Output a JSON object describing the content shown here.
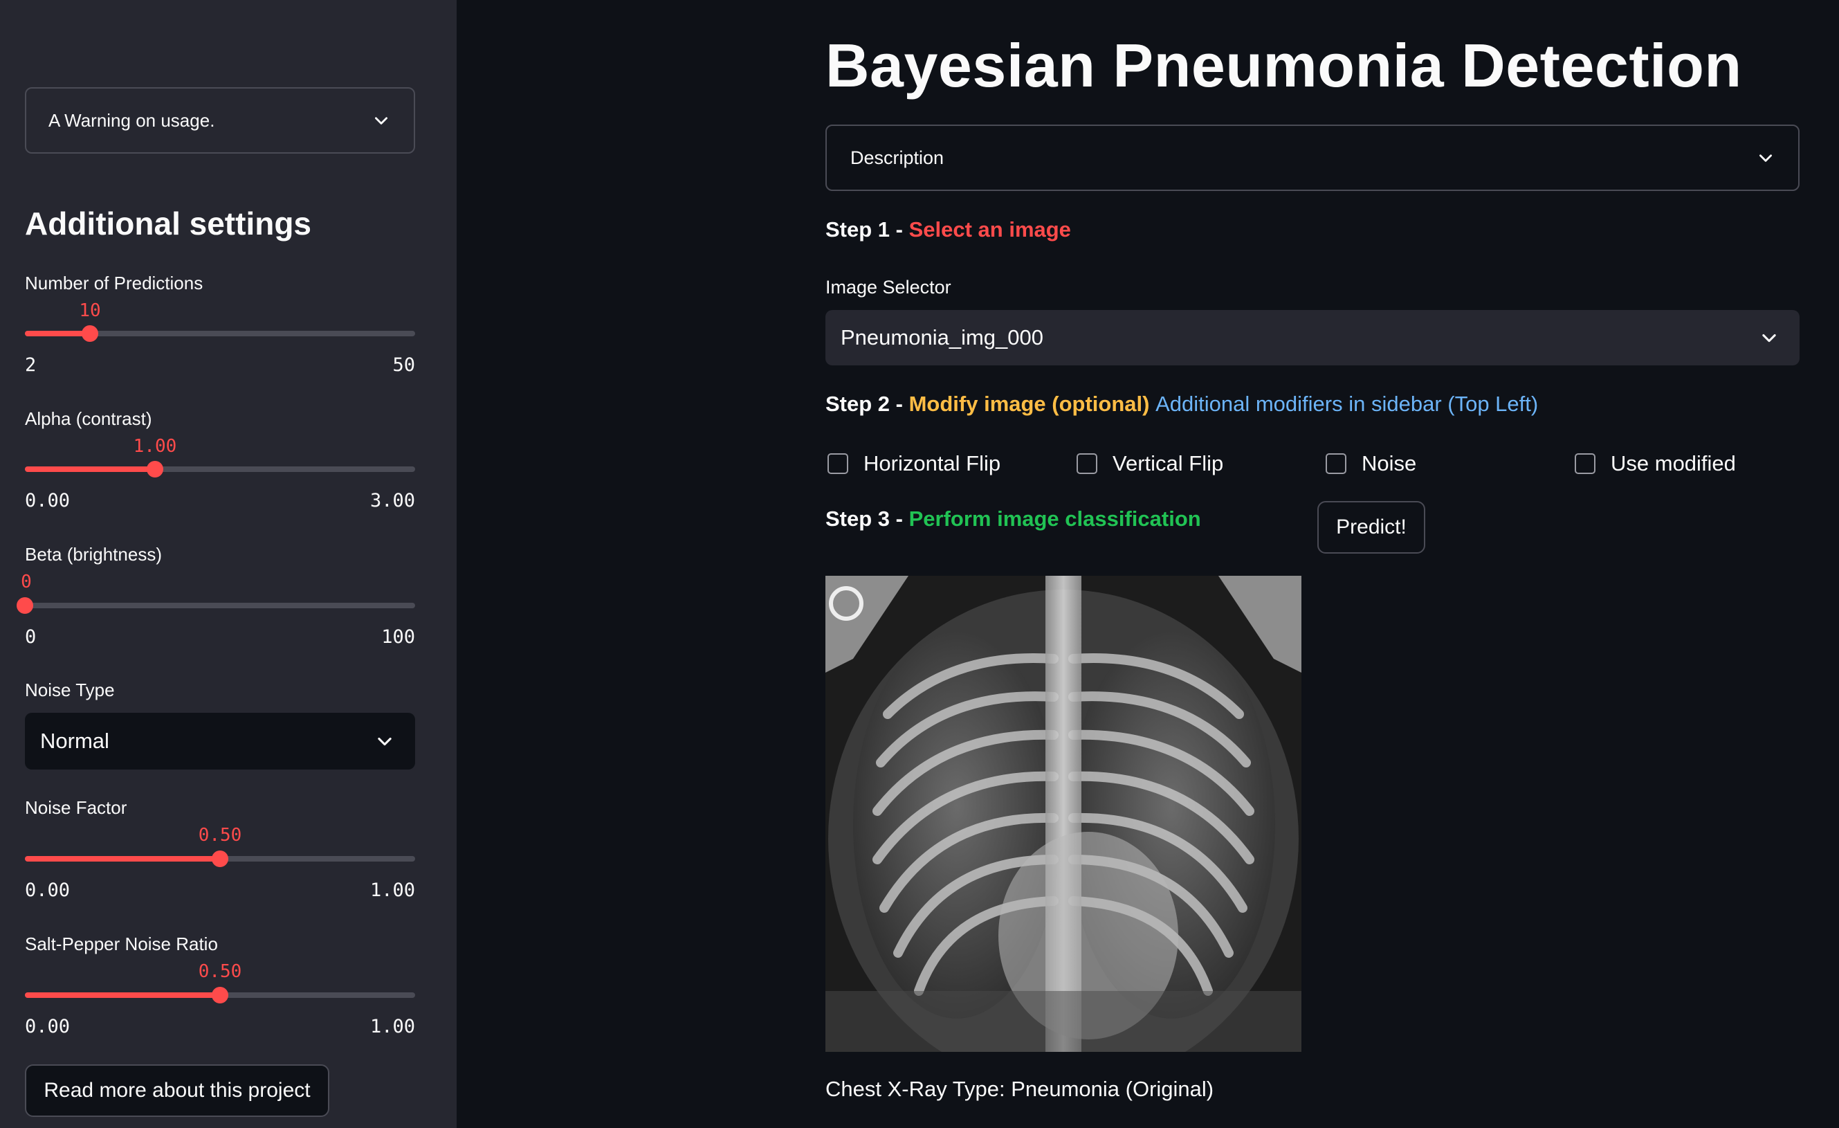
{
  "sidebar": {
    "warning_expander": "A Warning on usage.",
    "heading": "Additional settings",
    "sliders": [
      {
        "label": "Number of Predictions",
        "value": "10",
        "min": "2",
        "max": "50",
        "fraction": 0.1667
      },
      {
        "label": "Alpha (contrast)",
        "value": "1.00",
        "min": "0.00",
        "max": "3.00",
        "fraction": 0.3333
      },
      {
        "label": "Beta (brightness)",
        "value": "0",
        "min": "0",
        "max": "100",
        "fraction": 0.0
      },
      {
        "label": "Noise Factor",
        "value": "0.50",
        "min": "0.00",
        "max": "1.00",
        "fraction": 0.5
      },
      {
        "label": "Salt-Pepper Noise Ratio",
        "value": "0.50",
        "min": "0.00",
        "max": "1.00",
        "fraction": 0.5
      }
    ],
    "noise_type": {
      "label": "Noise Type",
      "value": "Normal"
    },
    "read_more_button": "Read more about this project"
  },
  "main": {
    "title": "Bayesian Pneumonia Detection",
    "description_expander": "Description",
    "step1": {
      "prefix": "Step 1 - ",
      "text": "Select an image"
    },
    "image_selector": {
      "label": "Image Selector",
      "value": "Pneumonia_img_000"
    },
    "step2": {
      "prefix": "Step 2 - ",
      "text": "Modify image (optional)",
      "note": "Additional modifiers in sidebar (Top Left)"
    },
    "checkboxes": [
      {
        "label": "Horizontal Flip",
        "checked": false
      },
      {
        "label": "Vertical Flip",
        "checked": false
      },
      {
        "label": "Noise",
        "checked": false
      },
      {
        "label": "Use modified",
        "checked": false
      }
    ],
    "step3": {
      "prefix": "Step 3 - ",
      "text": "Perform image classification"
    },
    "predict_button": "Predict!",
    "caption": "Chest X-Ray Type: Pneumonia (Original)"
  },
  "colors": {
    "background": "#0e1117",
    "sidebar": "#262730",
    "accent_red": "#ff4b4b",
    "orange": "#ffbd45",
    "blue": "#6cb4f8",
    "green": "#21c354"
  },
  "icons": {
    "expander": "chevron-down-icon",
    "select": "chevron-down-icon"
  }
}
